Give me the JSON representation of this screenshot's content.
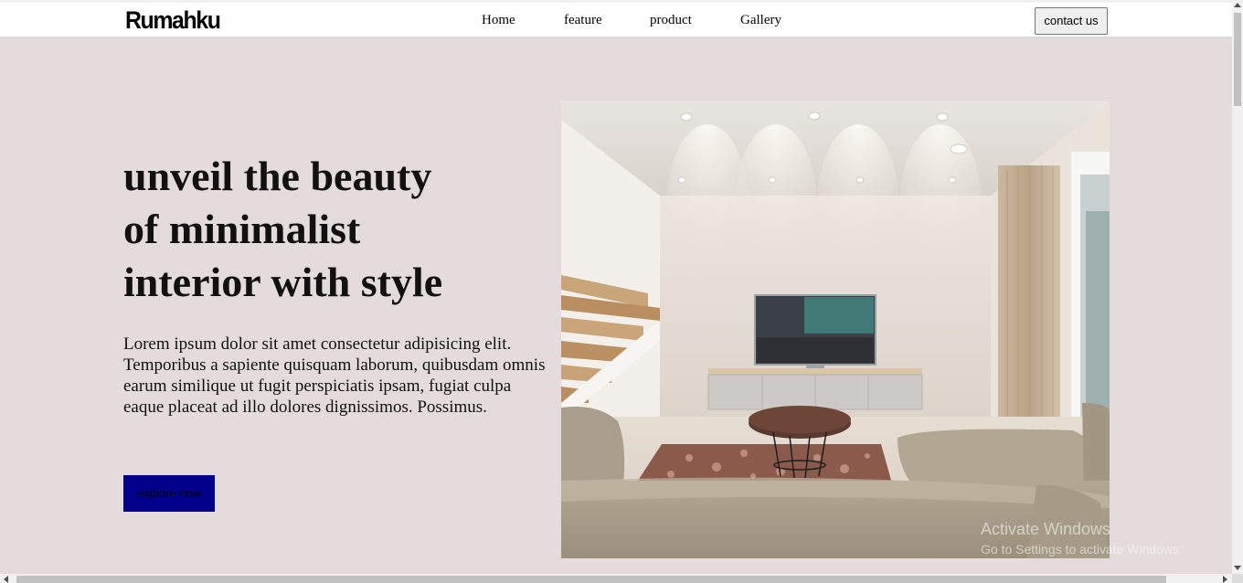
{
  "brand": {
    "logo": "Rumahku"
  },
  "nav": {
    "links": [
      {
        "label": "Home"
      },
      {
        "label": "feature"
      },
      {
        "label": "product"
      },
      {
        "label": "Gallery"
      }
    ],
    "contact_label": "contact us"
  },
  "hero": {
    "title_lines": [
      "unveil the beauty",
      "of minimalist",
      "interior with style"
    ],
    "text": "Lorem ipsum dolor sit amet consectetur adipisicing elit. Temporibus a sapiente quisquam laborum, quibusdam omnis earum similique ut fugit perspiciatis ipsam, fugiat culpa eaque placeat ad illo dolores dignissimos. Possimus.",
    "button_label": "explore now",
    "image": "minimalist-living-room-photo"
  },
  "watermark": {
    "title": "Activate Windows",
    "subtitle": "Go to Settings to activate Windows."
  },
  "colors": {
    "page_background": "#e3dbdc",
    "button_background": "#00008b",
    "navbar_background": "#ffffff"
  }
}
